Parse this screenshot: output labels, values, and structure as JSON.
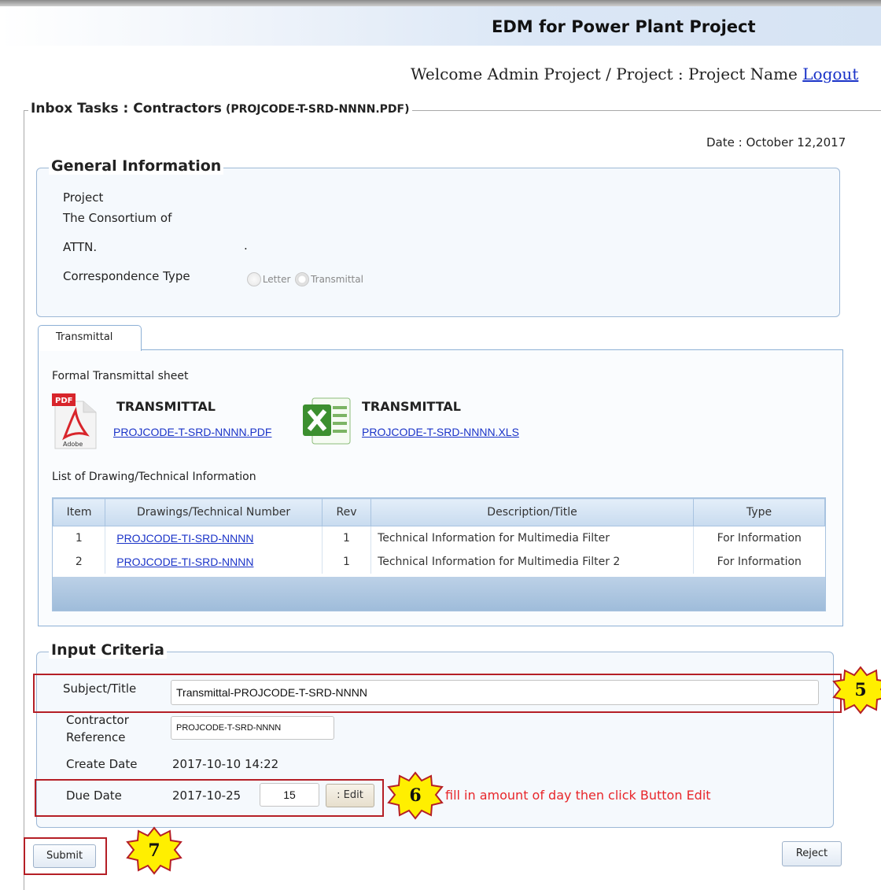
{
  "header": {
    "app_title": "EDM for Power Plant Project",
    "welcome_text": "Welcome Admin Project / Project : Project Name",
    "logout_label": "Logout"
  },
  "inbox": {
    "title": "Inbox Tasks : Contractors",
    "file_name": "(PROJCODE-T-SRD-NNNN.PDF)",
    "date_label": "Date : October 12,2017"
  },
  "general_info": {
    "legend": "General Information",
    "project_label": "Project",
    "consortium_label": "The Consortium of",
    "attn_label": "ATTN.",
    "attn_value": ".",
    "correspondence_label": "Correspondence Type",
    "options": [
      {
        "label": "Letter",
        "checked": false
      },
      {
        "label": "Transmittal",
        "checked": true
      }
    ]
  },
  "tab": {
    "label": "Transmittal",
    "sheet_label": "Formal Transmittal sheet",
    "pdf": {
      "title": "TRANSMITTAL",
      "link": "PROJCODE-T-SRD-NNNN.PDF",
      "icon": "pdf-file-icon",
      "adobe_text": "Adobe",
      "badge": "PDF"
    },
    "xls": {
      "title": "TRANSMITTAL",
      "link": "PROJCODE-T-SRD-NNNN.XLS",
      "icon": "excel-file-icon"
    },
    "list_label": "List of Drawing/Technical Information"
  },
  "table": {
    "columns": [
      "Item",
      "Drawings/Technical Number",
      "Rev",
      "Description/Title",
      "Type"
    ],
    "rows": [
      {
        "item": "1",
        "number": "PROJCODE-TI-SRD-NNNN",
        "rev": "1",
        "description": "Technical Information for Multimedia Filter",
        "type": "For Information"
      },
      {
        "item": "2",
        "number": "PROJCODE-TI-SRD-NNNN",
        "rev": "1",
        "description": "Technical Information for Multimedia Filter 2",
        "type": "For Information"
      }
    ]
  },
  "input_criteria": {
    "legend": "Input Criteria",
    "subject_label": "Subject/Title",
    "subject_value": "Transmittal-PROJCODE-T-SRD-NNNN",
    "contractor_label_1": "Contractor",
    "contractor_label_2": "Reference",
    "contractor_value": "PROJCODE-T-SRD-NNNN",
    "create_date_label": "Create Date",
    "create_date_value": "2017-10-10 14:22",
    "due_date_label": "Due Date",
    "due_date_value": "2017-10-25",
    "days_value": "15",
    "edit_label": ": Edit",
    "hint": "fill in amount of day then click Button Edit"
  },
  "actions": {
    "submit_label": "Submit",
    "reject_label": "Reject"
  },
  "callouts": [
    "5",
    "6",
    "7"
  ],
  "colors": {
    "link": "#1a33c8",
    "callout_box": "#b51f26",
    "callout_fill": "#ffef00",
    "hint": "#e8262a",
    "table_footer": "#a6c0dc"
  }
}
